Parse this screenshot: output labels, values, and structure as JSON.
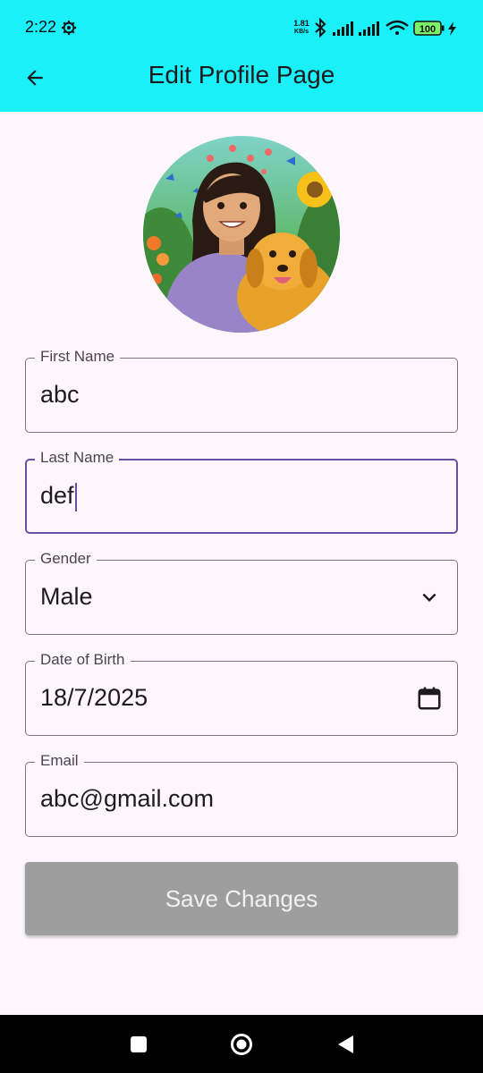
{
  "status_bar": {
    "time": "2:22",
    "net_speed_value": "1.81",
    "net_speed_unit": "KB/s",
    "battery": "100",
    "icons": [
      "settings-gear-icon",
      "bluetooth-icon",
      "signal-icon",
      "signal-icon",
      "wifi-icon",
      "battery-icon",
      "charging-bolt-icon"
    ]
  },
  "app_bar": {
    "title": "Edit Profile Page",
    "back_icon": "arrow-back-icon",
    "background": "#1af0f8"
  },
  "profile": {
    "avatar": "illustrated-girl-with-golden-retriever"
  },
  "form": {
    "first_name": {
      "label": "First Name",
      "value": "abc"
    },
    "last_name": {
      "label": "Last Name",
      "value": "def",
      "focused": true
    },
    "gender": {
      "label": "Gender",
      "value": "Male",
      "icon": "chevron-down-icon"
    },
    "dob": {
      "label": "Date of Birth",
      "value": "18/7/2025",
      "icon": "calendar-icon"
    },
    "email": {
      "label": "Email",
      "value": "abc@gmail.com"
    }
  },
  "actions": {
    "save_label": "Save Changes",
    "save_color": "#9e9e9e"
  },
  "colors": {
    "focus_border": "#6750a4",
    "page_background": "#fdf7fd"
  }
}
